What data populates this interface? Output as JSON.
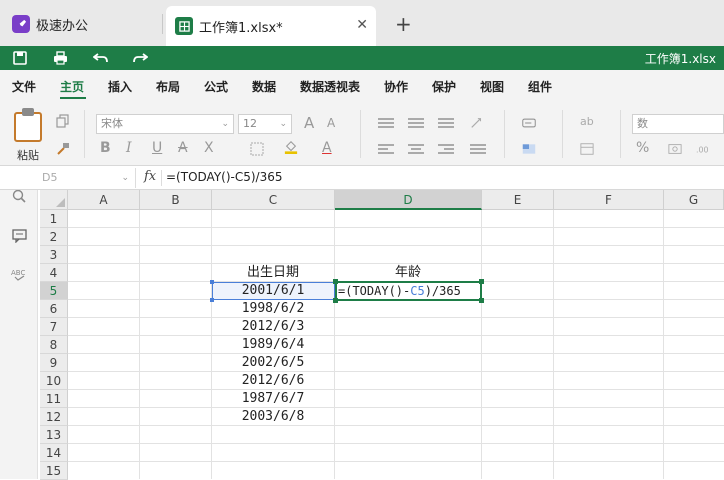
{
  "tabs": {
    "app_label": "极速办公",
    "doc_label": "工作簿1.xlsx*",
    "close_glyph": "✕",
    "add_glyph": "+"
  },
  "quickbar": {
    "doc_title": "工作簿1.xlsx"
  },
  "menu": {
    "items": [
      "文件",
      "主页",
      "插入",
      "布局",
      "公式",
      "数据",
      "数据透视表",
      "协作",
      "保护",
      "视图",
      "组件"
    ],
    "active": "主页"
  },
  "ribbon": {
    "paste_label": "粘贴",
    "font_name": "宋体",
    "font_size": "12",
    "number_format": "数",
    "bold": "B",
    "italic": "I",
    "underline": "U",
    "strike": "A",
    "subscript": "X",
    "grow_font": "A",
    "shrink_font": "A",
    "font_color": "A",
    "percent": "%"
  },
  "formula_bar": {
    "name_box": "D5",
    "fx": "fx",
    "formula": "=(TODAY()-C5)/365"
  },
  "sheet": {
    "columns": [
      "A",
      "B",
      "C",
      "D",
      "E",
      "F",
      "G"
    ],
    "selected_column": "D",
    "rows": [
      "1",
      "2",
      "3",
      "4",
      "5",
      "6",
      "7",
      "8",
      "9",
      "10",
      "11",
      "12",
      "13",
      "14",
      "15"
    ],
    "selected_row": "5",
    "header_c4": "出生日期",
    "header_d4": "年龄",
    "dates": [
      "2001/6/1",
      "1998/6/2",
      "2012/6/3",
      "1989/6/4",
      "2002/6/5",
      "2012/6/6",
      "1987/6/7",
      "2003/6/8"
    ],
    "editing_formula": {
      "prefix": "=(TODAY()-",
      "ref": "C5",
      "suffix": ")/365"
    }
  },
  "colors": {
    "accent": "#1e7d47",
    "reference_blue": "#4a7fd8"
  }
}
